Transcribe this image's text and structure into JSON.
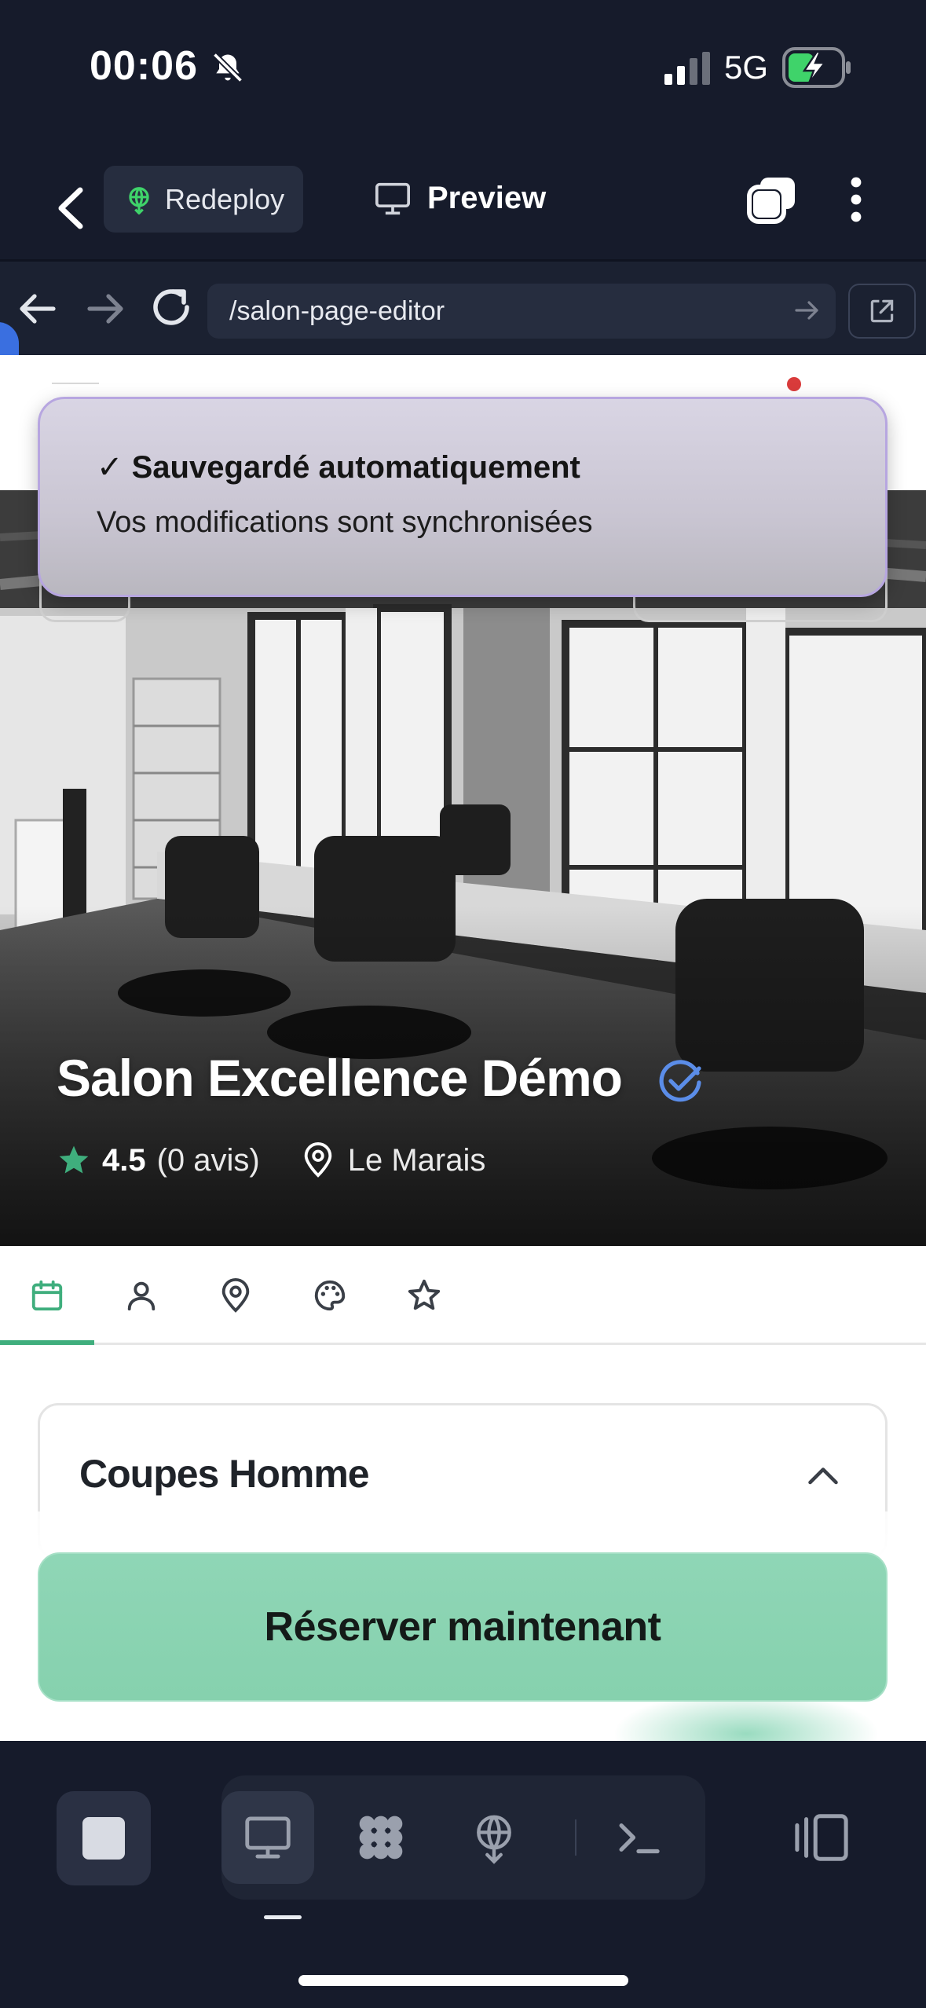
{
  "status_bar": {
    "time": "00:06",
    "network": "5G"
  },
  "toolbar": {
    "redeploy_label": "Redeploy",
    "preview_label": "Preview"
  },
  "browser": {
    "url": "/salon-page-editor"
  },
  "toast": {
    "title": "✓ Sauvegardé automatiquement",
    "message": "Vos modifications sont synchronisées"
  },
  "salon": {
    "name": "Salon Excellence Démo",
    "rating": "4.5",
    "reviews": "(0 avis)",
    "location": "Le Marais"
  },
  "tabs": [
    {
      "name": "calendar",
      "active": true
    },
    {
      "name": "person",
      "active": false
    },
    {
      "name": "location",
      "active": false
    },
    {
      "name": "palette",
      "active": false
    },
    {
      "name": "star",
      "active": false
    }
  ],
  "section": {
    "title": "Coupes Homme"
  },
  "cta": {
    "label": "Réserver maintenant"
  },
  "colors": {
    "accent_green": "#3fae7d",
    "cta_green": "#8fd6b6",
    "toast_border": "#b7a6e0",
    "verified_blue": "#5b8de8"
  }
}
